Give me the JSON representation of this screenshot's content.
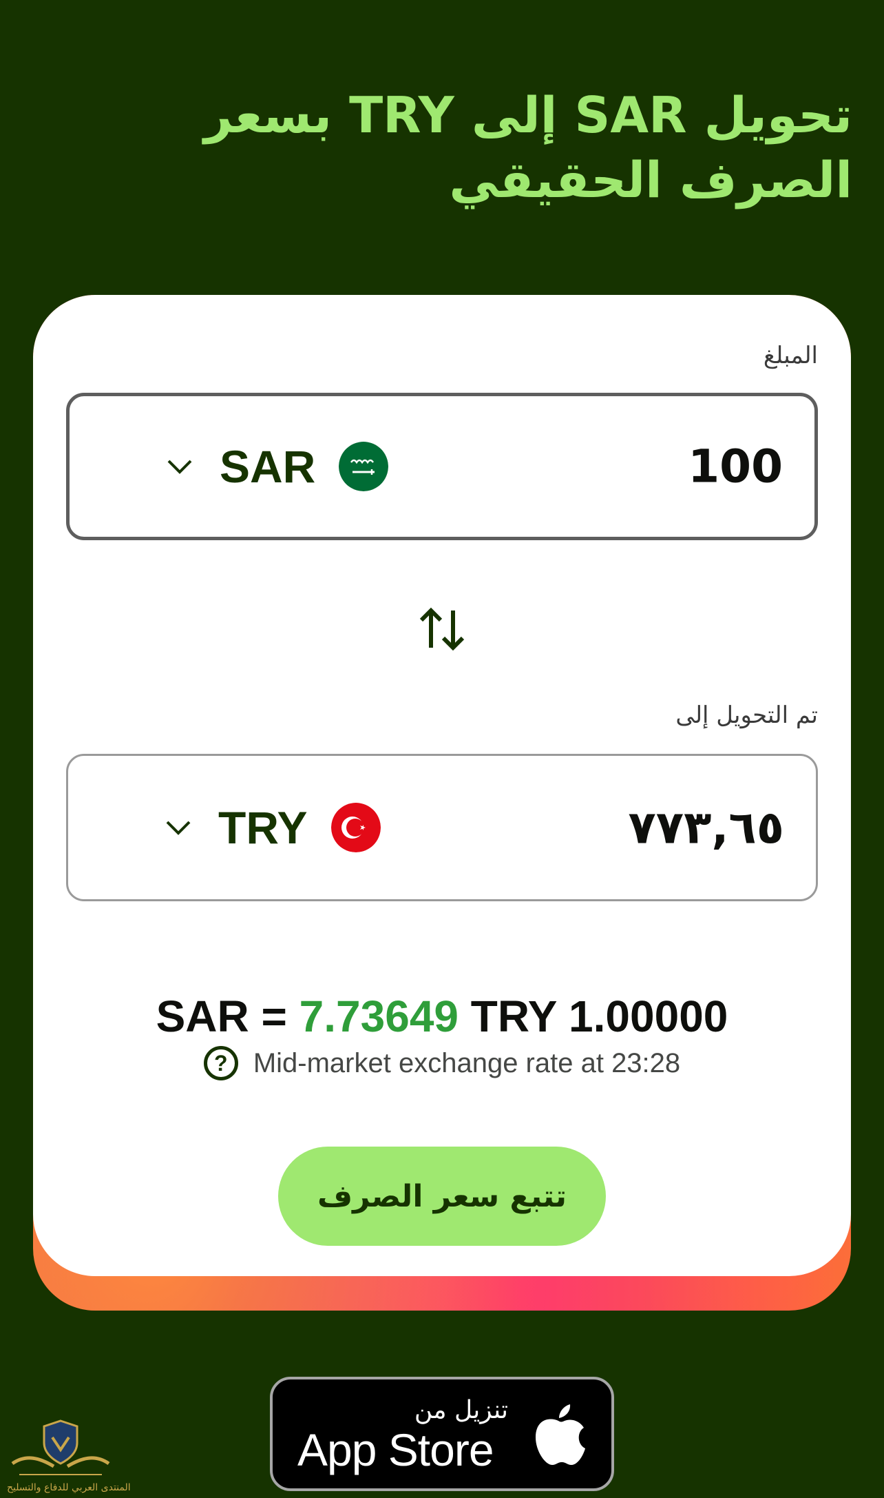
{
  "headline": "تحويل SAR إلى TRY بسعر الصرف الحقيقي",
  "converter": {
    "amount_label": "المبلغ",
    "amount_value": "100",
    "source_currency": "SAR",
    "converted_label": "تم التحويل إلى",
    "converted_value": "٧٧٣,٦٥",
    "target_currency": "TRY"
  },
  "rate": {
    "base": "1.00000",
    "base_currency": "SAR",
    "equals": "=",
    "value": "7.73649",
    "target_currency": "TRY",
    "mid_market_text": "Mid-market exchange rate at 23:28"
  },
  "track_button_label": "تتبع سعر الصرف",
  "app_store": {
    "small_text": "تنزيل من",
    "big_text": "App Store"
  },
  "watermark_text": "المنتدى العربي للدفاع والتسليح",
  "colors": {
    "background": "#163300",
    "accent": "#9fe870",
    "rate_number": "#2f9e3a"
  }
}
